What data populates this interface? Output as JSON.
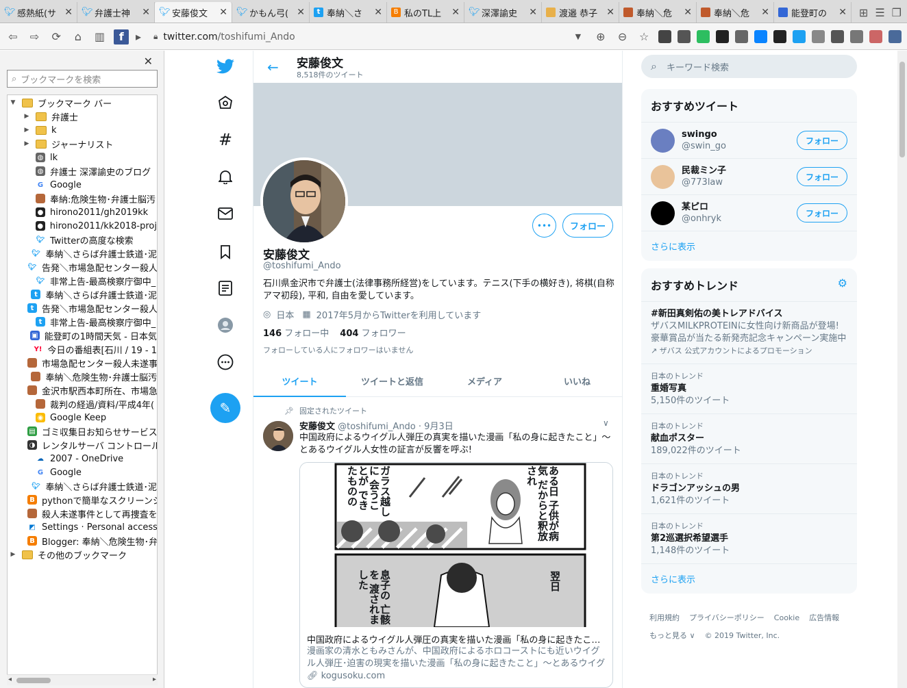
{
  "tabs": [
    {
      "title": "感熱紙(サ",
      "icon": "twitter-icon",
      "active": false
    },
    {
      "title": "弁護士神",
      "icon": "twitter-icon",
      "active": false
    },
    {
      "title": "安藤俊文",
      "icon": "twitter-icon",
      "active": true
    },
    {
      "title": "かもん弓(",
      "icon": "twitter-icon",
      "active": false
    },
    {
      "title": "奉納＼さ",
      "icon": "twitter-square-icon",
      "active": false
    },
    {
      "title": "私のTL上",
      "icon": "blogger-icon",
      "active": false
    },
    {
      "title": "深澤諭史",
      "icon": "twitter-icon",
      "active": false
    },
    {
      "title": "渡邉 恭子",
      "icon": "image-icon",
      "active": false
    },
    {
      "title": "奉納＼危",
      "icon": "picture-icon",
      "active": false
    },
    {
      "title": "奉納＼危",
      "icon": "picture-icon",
      "active": false
    },
    {
      "title": "能登町の",
      "icon": "cube-icon",
      "active": false
    }
  ],
  "address": {
    "domain": "twitter.com",
    "path": "/toshifumi_Ando"
  },
  "extensions": [
    "ext",
    "bm",
    "ever",
    "URL",
    "nav",
    "dl",
    "ed",
    "tw",
    "font",
    "ext2",
    "ext3",
    "av",
    "av2"
  ],
  "bookmarks": {
    "search_placeholder": "ブックマークを検索",
    "root": "ブックマーク バー",
    "other": "その他のブックマーク",
    "items": [
      {
        "label": "弁護士",
        "kind": "folder"
      },
      {
        "label": "k",
        "kind": "folder"
      },
      {
        "label": "ジャーナリスト",
        "kind": "folder"
      },
      {
        "label": "lk",
        "kind": "globe"
      },
      {
        "label": "弁護士 深澤諭史のブログ",
        "kind": "globe"
      },
      {
        "label": "Google",
        "kind": "google"
      },
      {
        "label": "奉納:危険生物･弁護士脳汚",
        "kind": "pic"
      },
      {
        "label": "hirono2011/gh2019kk",
        "kind": "github"
      },
      {
        "label": "hirono2011/kk2018-proj",
        "kind": "github"
      },
      {
        "label": "Twitterの高度な検索",
        "kind": "twitter"
      },
      {
        "label": "奉納＼さらば弁護士鉄道･泥",
        "kind": "twitter"
      },
      {
        "label": "告発＼市場急配センター殺人",
        "kind": "twitter"
      },
      {
        "label": "非常上告-最高検察庁御中_",
        "kind": "twitter"
      },
      {
        "label": "奉納＼さらば弁護士鉄道･泥",
        "kind": "tsq"
      },
      {
        "label": "告発＼市場急配センター殺人",
        "kind": "tsq"
      },
      {
        "label": "非常上告-最高検察庁御中_",
        "kind": "tsq"
      },
      {
        "label": "能登町の1時間天気 - 日本気",
        "kind": "cube"
      },
      {
        "label": "今日の番組表[石川 / 19 - 1",
        "kind": "yahoo"
      },
      {
        "label": "市場急配センター殺人未遂事",
        "kind": "pic"
      },
      {
        "label": "奉納＼危険生物･弁護士脳汚",
        "kind": "pic"
      },
      {
        "label": "金沢市駅西本町所在、市場急",
        "kind": "pic"
      },
      {
        "label": "裁判の経過/資料/平成4年(",
        "kind": "pic"
      },
      {
        "label": "Google Keep",
        "kind": "keep"
      },
      {
        "label": "ゴミ収集日お知らせサービス",
        "kind": "green"
      },
      {
        "label": "レンタルサーバ コントロール",
        "kind": "dark"
      },
      {
        "label": "2007 - OneDrive",
        "kind": "onedrive"
      },
      {
        "label": "Google",
        "kind": "google"
      },
      {
        "label": "奉納＼さらば弁護士鉄道･泥",
        "kind": "twitter"
      },
      {
        "label": "pythonで簡単なスクリーンシ",
        "kind": "blogger"
      },
      {
        "label": "殺人未遂事件として再捜査を",
        "kind": "pic"
      },
      {
        "label": "Settings · Personal access",
        "kind": "azure"
      },
      {
        "label": "Blogger: 奉納＼危険生物･弁",
        "kind": "blogger"
      }
    ]
  },
  "profile": {
    "header_name": "安藤俊文",
    "tweet_count": "8,518件のツイート",
    "name": "安藤俊文",
    "handle": "@toshifumi_Ando",
    "bio": "石川県金沢市で弁護士(法律事務所経営)をしています。テニス(下手の横好き), 将棋(自称アマ初段), 平和, 自由を愛しています。",
    "location": "日本",
    "joined": "2017年5月からTwitterを利用しています",
    "following_num": "146",
    "following_label": "フォロー中",
    "followers_num": "404",
    "followers_label": "フォロワー",
    "note": "フォローしている人にフォロワーはいません",
    "follow_button": "フォロー",
    "more_button": "•••"
  },
  "profile_tabs": [
    "ツイート",
    "ツイートと返信",
    "メディア",
    "いいね"
  ],
  "tweet": {
    "pinned_label": "固定されたツイート",
    "name": "安藤俊文",
    "handle": "@toshifumi_Ando",
    "date": "· 9月3日",
    "text": "中国政府によるウイグル人弾圧の真実を描いた漫画「私の身に起きたこと」～とあるウイグル人女性の証言が反響を呼ぶ!",
    "card_title": "中国政府によるウイグル人弾圧の真実を描いた漫画「私の身に起きたこと」…",
    "card_desc": "漫画家の清水ともみさんが、中国政府によるホロコーストにも近いウイグル人弾圧･迫害の現実を描いた漫画「私の身に起きたこと」～とあるウイグル人…",
    "card_link": "kogusoku.com",
    "manga_top_right": "ある日 子供が病気 だからと釈放され",
    "manga_top_left": "ガラス越しに 会うことが できたものの",
    "manga_bottom_right": "翌日",
    "manga_bottom_left": "息子の 亡骸を 渡されました"
  },
  "right": {
    "search_placeholder": "キーワード検索",
    "recommend_title": "おすすめツイート",
    "follow_label": "フォロー",
    "users": [
      {
        "name": "swingo",
        "handle": "@swin_go",
        "color": "#6a7fc1"
      },
      {
        "name": "民裁ミン子",
        "handle": "@773law",
        "color": "#e9c39a"
      },
      {
        "name": "某ピロ",
        "handle": "@onhryk",
        "color": "#000000"
      }
    ],
    "show_more": "さらに表示",
    "trends_title": "おすすめトレンド",
    "promo": {
      "name": "#新田真剣佑の美トレアドバイス",
      "desc": "ザバスMILKPROTEINに女性向け新商品が登場!豪華賞品が当たる新発売記念キャンペーン実施中",
      "by": "ザバス 公式アカウントによるプロモーション"
    },
    "trends": [
      {
        "context": "日本のトレンド",
        "name": "重婚写真",
        "count": "5,150件のツイート"
      },
      {
        "context": "日本のトレンド",
        "name": "献血ポスター",
        "count": "189,022件のツイート"
      },
      {
        "context": "日本のトレンド",
        "name": "ドラゴンアッシュの男",
        "count": "1,621件のツイート"
      },
      {
        "context": "日本のトレンド",
        "name": "第2巡選択希望選手",
        "count": "1,148件のツイート"
      }
    ],
    "footer_links": [
      "利用規約",
      "プライバシーポリシー",
      "Cookie",
      "広告情報"
    ],
    "footer_more": "もっと見る ∨",
    "copyright": "© 2019 Twitter, Inc."
  },
  "colors": {
    "accent": "#1da1f2",
    "muted": "#657786",
    "banner": "#ccd6dd"
  }
}
